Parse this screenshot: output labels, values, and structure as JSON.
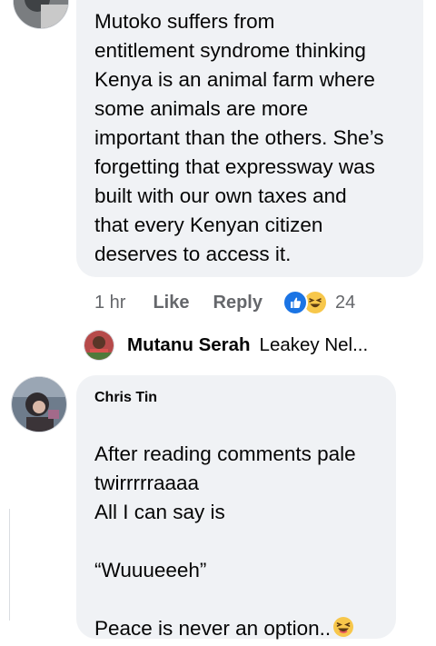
{
  "comment1": {
    "text": "Mutoko suffers from\nentitlement syndrome  thinking\nKenya is an animal farm where\nsome animals are more\nimportant than the others. She’s\nforgetting that expressway was\nbuilt with our own taxes and\nthat every Kenyan citizen\ndeserves to access it.",
    "time": "1 hr",
    "like_label": "Like",
    "reply_label": "Reply",
    "reaction_count": "24",
    "reactions": [
      "like-icon",
      "haha-icon"
    ]
  },
  "reply_preview": {
    "name": "Mutanu Serah",
    "snippet": "Leakey Nel..."
  },
  "comment2": {
    "author": "Chris Tin",
    "text": "After reading comments pale\ntwirrrrraaaa\nAll I can say is\n\n“Wuuueeeh”\n\nPeace is never an option..",
    "trailing_emoji": "grinning-squinting-face"
  },
  "colors": {
    "bubble": "#f0f2f5",
    "secondary_text": "#65676b",
    "like_blue": "#1b74e4",
    "haha_yellow": "#f7c74b"
  }
}
